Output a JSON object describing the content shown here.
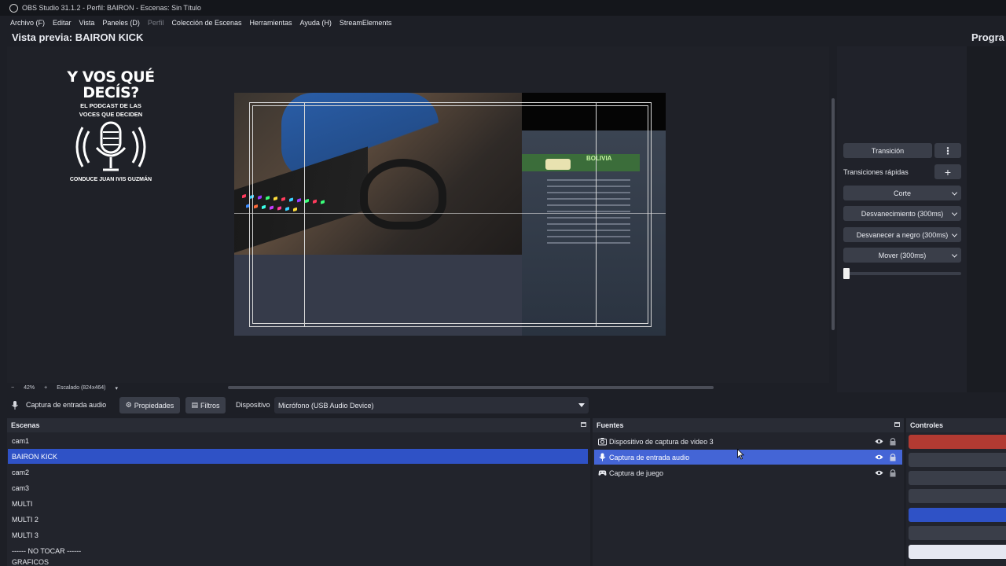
{
  "window": {
    "title": "OBS Studio 31.1.2 - Perfil: BAIRON - Escenas: Sin Título"
  },
  "menu": [
    "Archivo (F)",
    "Editar",
    "Vista",
    "Paneles (D)",
    "Perfil",
    "Colección de Escenas",
    "Herramientas",
    "Ayuda (H)",
    "StreamElements"
  ],
  "menu_disabled_index": 4,
  "preview": {
    "title": "Vista previa: BAIRON KICK",
    "program_title": "Progra",
    "logo": {
      "line1": "Y VOS QUÉ",
      "line2": "DECÍS?",
      "sub1": "EL PODCAST DE LAS",
      "sub2": "VOCES QUE DECIDEN",
      "host": "CONDUCE JUAN IVIS GUZMÁN"
    },
    "browser_text": "BOLIVIA"
  },
  "status": {
    "minus": "−",
    "zoom": "42%",
    "plus": "+",
    "scale": "Escalado (824x464)",
    "dropdown": "▾"
  },
  "transitions": {
    "transition_button": "Transición",
    "more_icon": "⋮",
    "quick_label": "Transiciones rápidas",
    "add_icon": "+",
    "items": [
      "Corte",
      "Desvanecimiento (300ms)",
      "Desvanecer a negro (300ms)",
      "Mover (300ms)"
    ]
  },
  "source_toolbar": {
    "source_name": "Captura de entrada audio",
    "properties": "Propiedades",
    "filters": "Filtros",
    "device_label": "Dispositivo",
    "device_value": "Micrófono (USB Audio Device)"
  },
  "scenes": {
    "header": "Escenas",
    "items": [
      "cam1",
      "BAIRON KICK",
      "cam2",
      "cam3",
      "MULTI",
      "MULTI 2",
      "MULTI 3",
      "------ NO TOCAR ------",
      "GRAFICOS"
    ],
    "selected_index": 1
  },
  "sources": {
    "header": "Fuentes",
    "items": [
      {
        "name": "Dispositivo de captura de video 3",
        "icon": "camera-icon"
      },
      {
        "name": "Captura de entrada audio",
        "icon": "mic-icon"
      },
      {
        "name": "Captura de juego",
        "icon": "gamepad-icon"
      }
    ],
    "selected_index": 1
  },
  "controls": {
    "header": "Controles",
    "button_colors": [
      "#b23a32",
      "#3a3e49",
      "#3a3e49",
      "#3a3e49",
      "#2f52c6",
      "#3a3e49",
      "#e6e8f2"
    ]
  },
  "colors": {
    "selection": "#2f52c6",
    "source_selection": "#4465d6",
    "background": "#1d1f26"
  }
}
